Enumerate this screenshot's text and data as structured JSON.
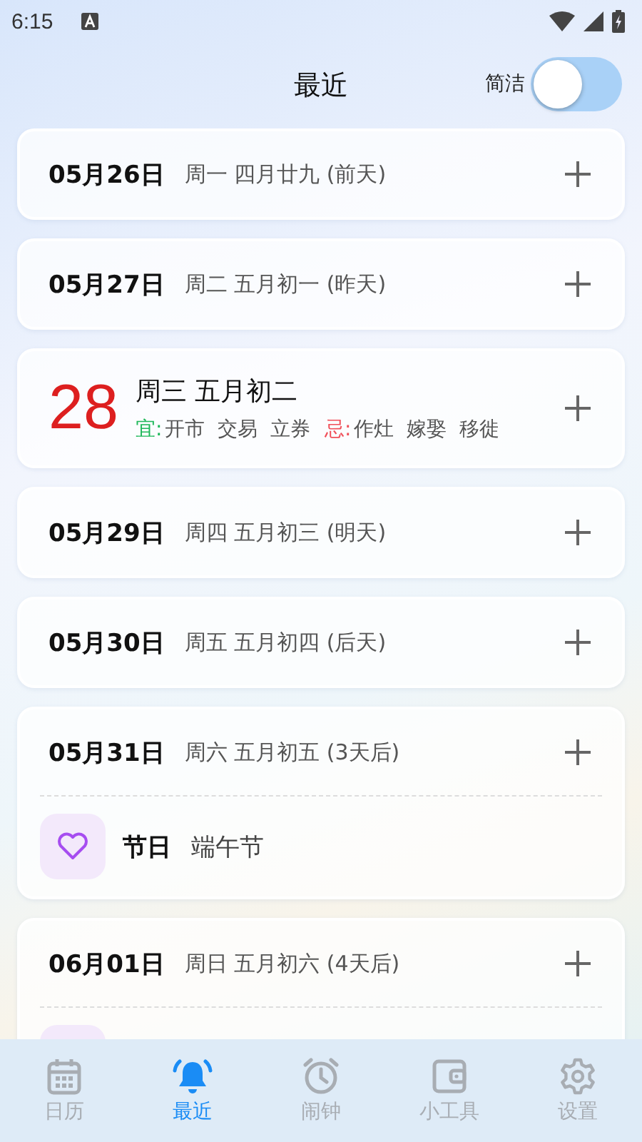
{
  "status_bar": {
    "time": "6:15"
  },
  "header": {
    "title": "最近",
    "toggle": {
      "label": "简洁",
      "on": false
    }
  },
  "days": [
    {
      "kind": "normal",
      "date": "05月26日",
      "info": "周一 四月廿九 (前天)"
    },
    {
      "kind": "normal",
      "date": "05月27日",
      "info": "周二 五月初一 (昨天)"
    },
    {
      "kind": "today",
      "day": "28",
      "info": "周三 五月初二",
      "good_label": "宜:",
      "good": "开市  交易  立券",
      "bad_label": "忌:",
      "bad": "作灶  嫁娶  移徙"
    },
    {
      "kind": "normal",
      "date": "05月29日",
      "info": "周四 五月初三 (明天)"
    },
    {
      "kind": "normal",
      "date": "05月30日",
      "info": "周五 五月初四 (后天)"
    },
    {
      "kind": "normal",
      "date": "05月31日",
      "info": "周六 五月初五 (3天后)",
      "events": [
        {
          "kind": "holiday",
          "label": "节日",
          "name": "端午节"
        }
      ]
    },
    {
      "kind": "normal",
      "date": "06月01日",
      "info": "周日 五月初六 (4天后)",
      "events": [
        {
          "kind": "holiday"
        }
      ]
    }
  ],
  "nav": [
    {
      "kind": "calendar",
      "label": "日历",
      "selected": false
    },
    {
      "kind": "bell",
      "label": "最近",
      "selected": true
    },
    {
      "kind": "alarm",
      "label": "闹钟",
      "selected": false
    },
    {
      "kind": "wallet",
      "label": "小工具",
      "selected": false
    },
    {
      "kind": "gear",
      "label": "设置",
      "selected": false
    }
  ]
}
